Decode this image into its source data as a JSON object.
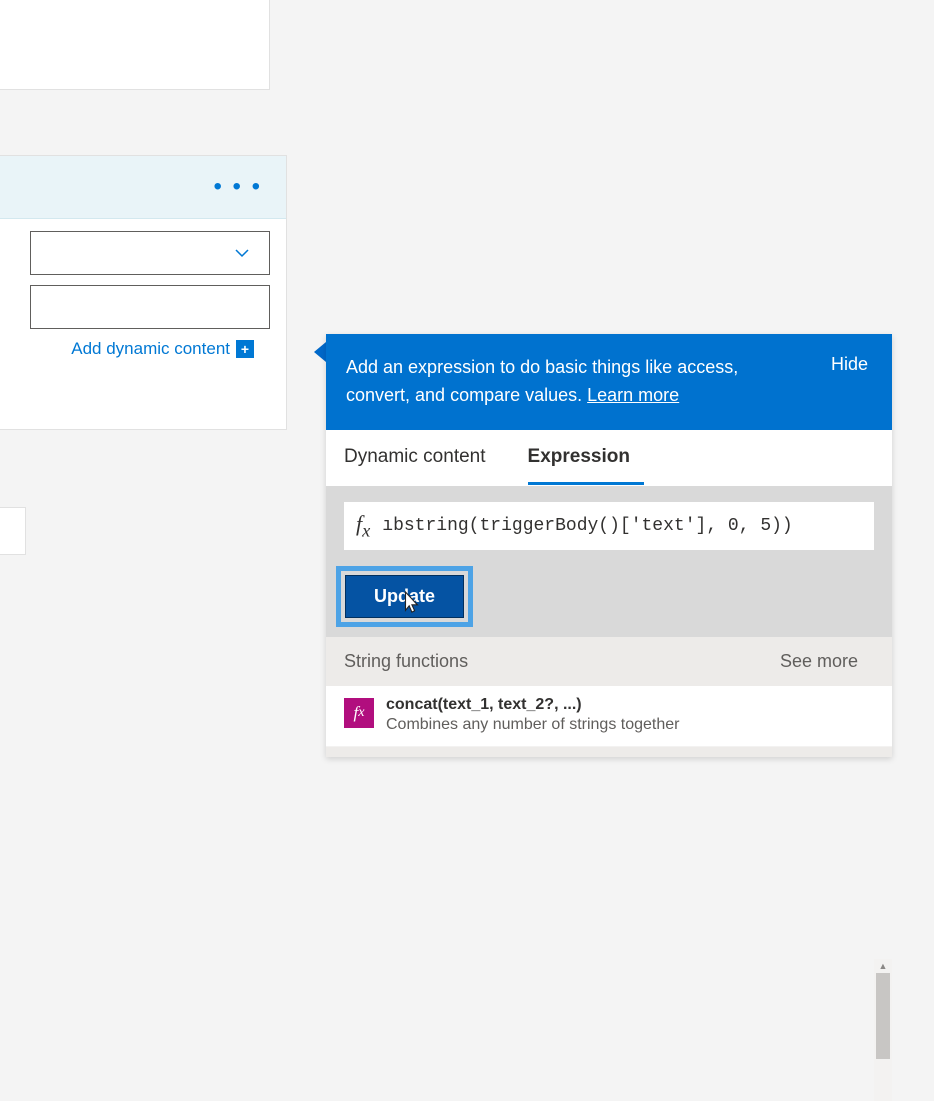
{
  "left_card": {
    "add_dynamic_label": "Add dynamic content"
  },
  "expression_panel": {
    "header_text": "Add an expression to do basic things like access, convert, and compare values. ",
    "learn_more": "Learn more",
    "hide": "Hide",
    "tabs": {
      "dynamic": "Dynamic content",
      "expression": "Expression"
    },
    "fx_value": "ıbstring(triggerBody()['text'], 0, 5))",
    "update_label": "Update",
    "section_title": "String functions",
    "see_more": "See more",
    "functions": [
      {
        "title": "concat(text_1, text_2?, ...)",
        "desc": "Combines any number of strings together"
      }
    ]
  }
}
